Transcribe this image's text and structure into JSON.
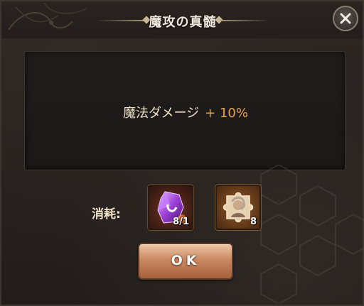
{
  "dialog": {
    "title": "魔攻の真髄",
    "bonus_label": "魔法ダメージ",
    "bonus_value": "+ 10%",
    "cost_label": "消耗:",
    "items": [
      {
        "icon": "purple-crystal-icon",
        "count": "8/1"
      },
      {
        "icon": "portrait-puzzle-icon",
        "count": "8"
      }
    ],
    "ok_label": "OK"
  },
  "colors": {
    "accent_orange": "#e6a24a",
    "text_cream": "#efe2c7",
    "button_top": "#f0c6a4",
    "button_bottom": "#a8603c"
  }
}
